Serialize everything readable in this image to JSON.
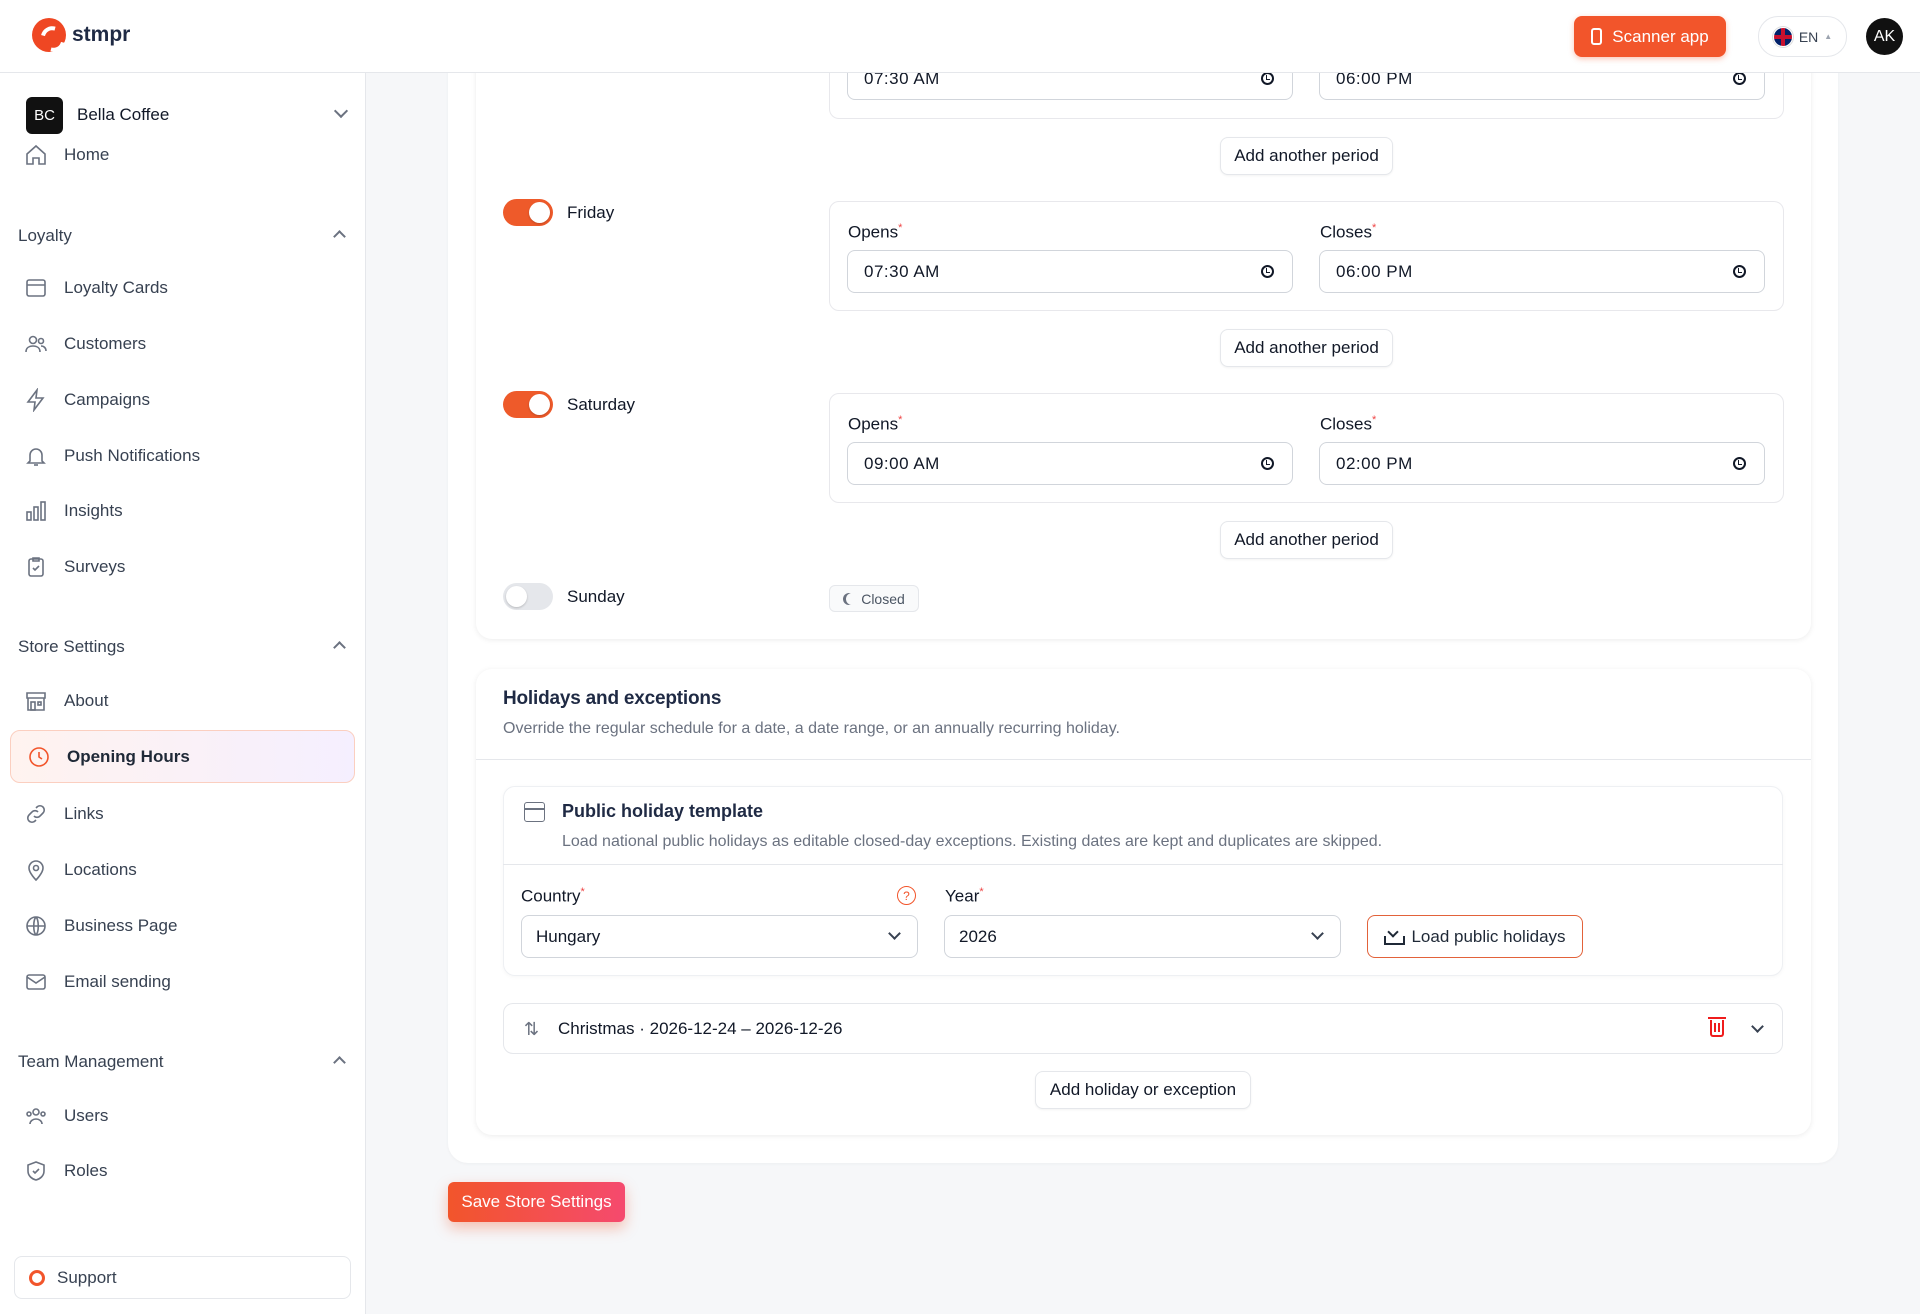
{
  "header": {
    "logo_text": "stmpr",
    "scanner_label": "Scanner app",
    "lang_label": "EN",
    "avatar_initials": "AK"
  },
  "sidebar": {
    "org": {
      "initials": "BC",
      "name": "Bella Coffee"
    },
    "home_label": "Home",
    "sections": {
      "loyalty": "Loyalty",
      "store_settings": "Store Settings",
      "team_management": "Team Management"
    },
    "items": {
      "loyalty_cards": "Loyalty Cards",
      "customers": "Customers",
      "campaigns": "Campaigns",
      "push_notifications": "Push Notifications",
      "insights": "Insights",
      "surveys": "Surveys",
      "about": "About",
      "opening_hours": "Opening Hours",
      "links": "Links",
      "locations": "Locations",
      "business_page": "Business Page",
      "email_sending": "Email sending",
      "users": "Users",
      "roles": "Roles"
    },
    "support_label": "Support"
  },
  "schedule": {
    "opens_label": "Opens",
    "closes_label": "Closes",
    "add_period_label": "Add another period",
    "partial_top": {
      "opens": "07:30 AM",
      "closes": "06:00 PM"
    },
    "days": [
      {
        "name": "Friday",
        "enabled": true,
        "opens": "07:30 AM",
        "closes": "06:00 PM"
      },
      {
        "name": "Saturday",
        "enabled": true,
        "opens": "09:00 AM",
        "closes": "02:00 PM"
      },
      {
        "name": "Sunday",
        "enabled": false,
        "status": "Closed"
      }
    ]
  },
  "holidays": {
    "title": "Holidays and exceptions",
    "subtitle": "Override the regular schedule for a date, a date range, or an annually recurring holiday.",
    "template": {
      "title": "Public holiday template",
      "subtitle": "Load national public holidays as editable closed-day exceptions. Existing dates are kept and duplicates are skipped.",
      "country_label": "Country",
      "country_value": "Hungary",
      "year_label": "Year",
      "year_value": "2026",
      "load_label": "Load public holidays"
    },
    "entries": [
      {
        "text": "Christmas · 2026-12-24 – 2026-12-26"
      }
    ],
    "add_label": "Add holiday or exception"
  },
  "save_label": "Save Store Settings",
  "colors": {
    "accent": "#f2552b",
    "toggle_on": "#ee5a2a",
    "delete": "#ef1c1c"
  }
}
